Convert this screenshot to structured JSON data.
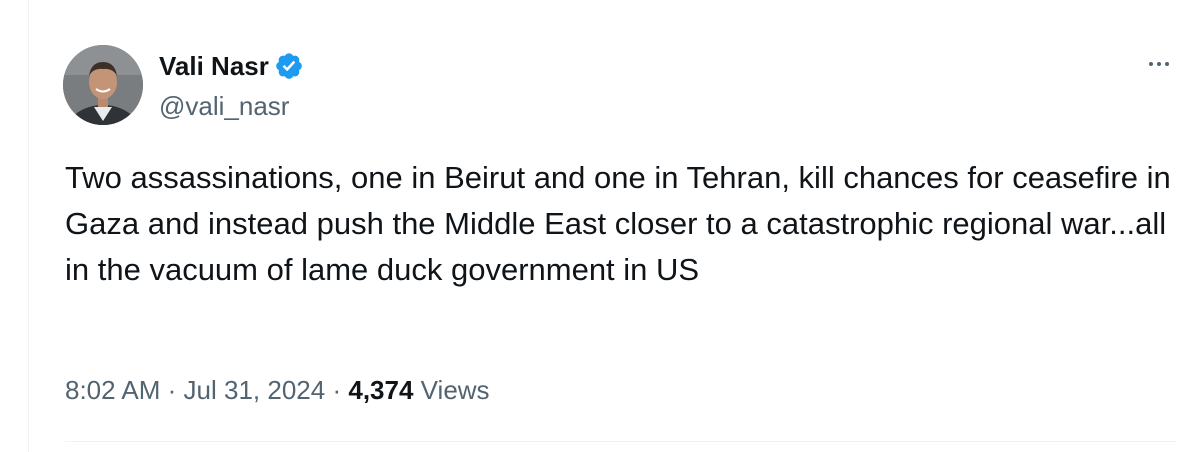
{
  "author": {
    "display_name": "Vali Nasr",
    "handle": "@vali_nasr",
    "verified": true,
    "verified_color": "#1d9bf0"
  },
  "menu": {
    "icon": "more-horizontal-icon"
  },
  "tweet": {
    "text": "Two assassinations, one in Beirut and one in Tehran, kill chances for ceasefire in Gaza and instead push the Middle East closer to a catastrophic regional war...all in the vacuum of lame duck government in US",
    "time": "8:02 AM",
    "separator": "·",
    "date": "Jul 31, 2024",
    "views_count": "4,374",
    "views_label": "Views"
  },
  "colors": {
    "text_primary": "#0f1419",
    "text_secondary": "#536471",
    "border": "#eff3f4"
  }
}
